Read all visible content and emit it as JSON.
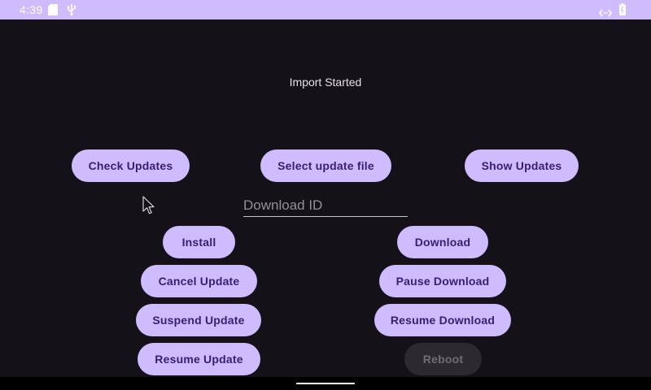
{
  "status_bar": {
    "time": "4:39",
    "icons": [
      "sd-card-icon",
      "usb-icon",
      "data-sync-icon",
      "battery-icon"
    ]
  },
  "main": {
    "status_text": "Import Started",
    "top_buttons": {
      "check_updates": "Check Updates",
      "select_update_file": "Select update file",
      "show_updates": "Show Updates"
    },
    "download_id": {
      "placeholder": "Download ID",
      "value": ""
    },
    "left_buttons": {
      "install": "Install",
      "cancel_update": "Cancel Update",
      "suspend_update": "Suspend Update",
      "resume_update": "Resume Update"
    },
    "right_buttons": {
      "download": "Download",
      "pause_download": "Pause Download",
      "resume_download": "Resume Download",
      "reboot": "Reboot"
    }
  },
  "colors": {
    "background": "#141218",
    "status_bar": "#cfbcff",
    "button": "#cfbcff",
    "button_text": "#381e72",
    "disabled_button": "#2c2a30",
    "disabled_text": "#6f6c74"
  }
}
